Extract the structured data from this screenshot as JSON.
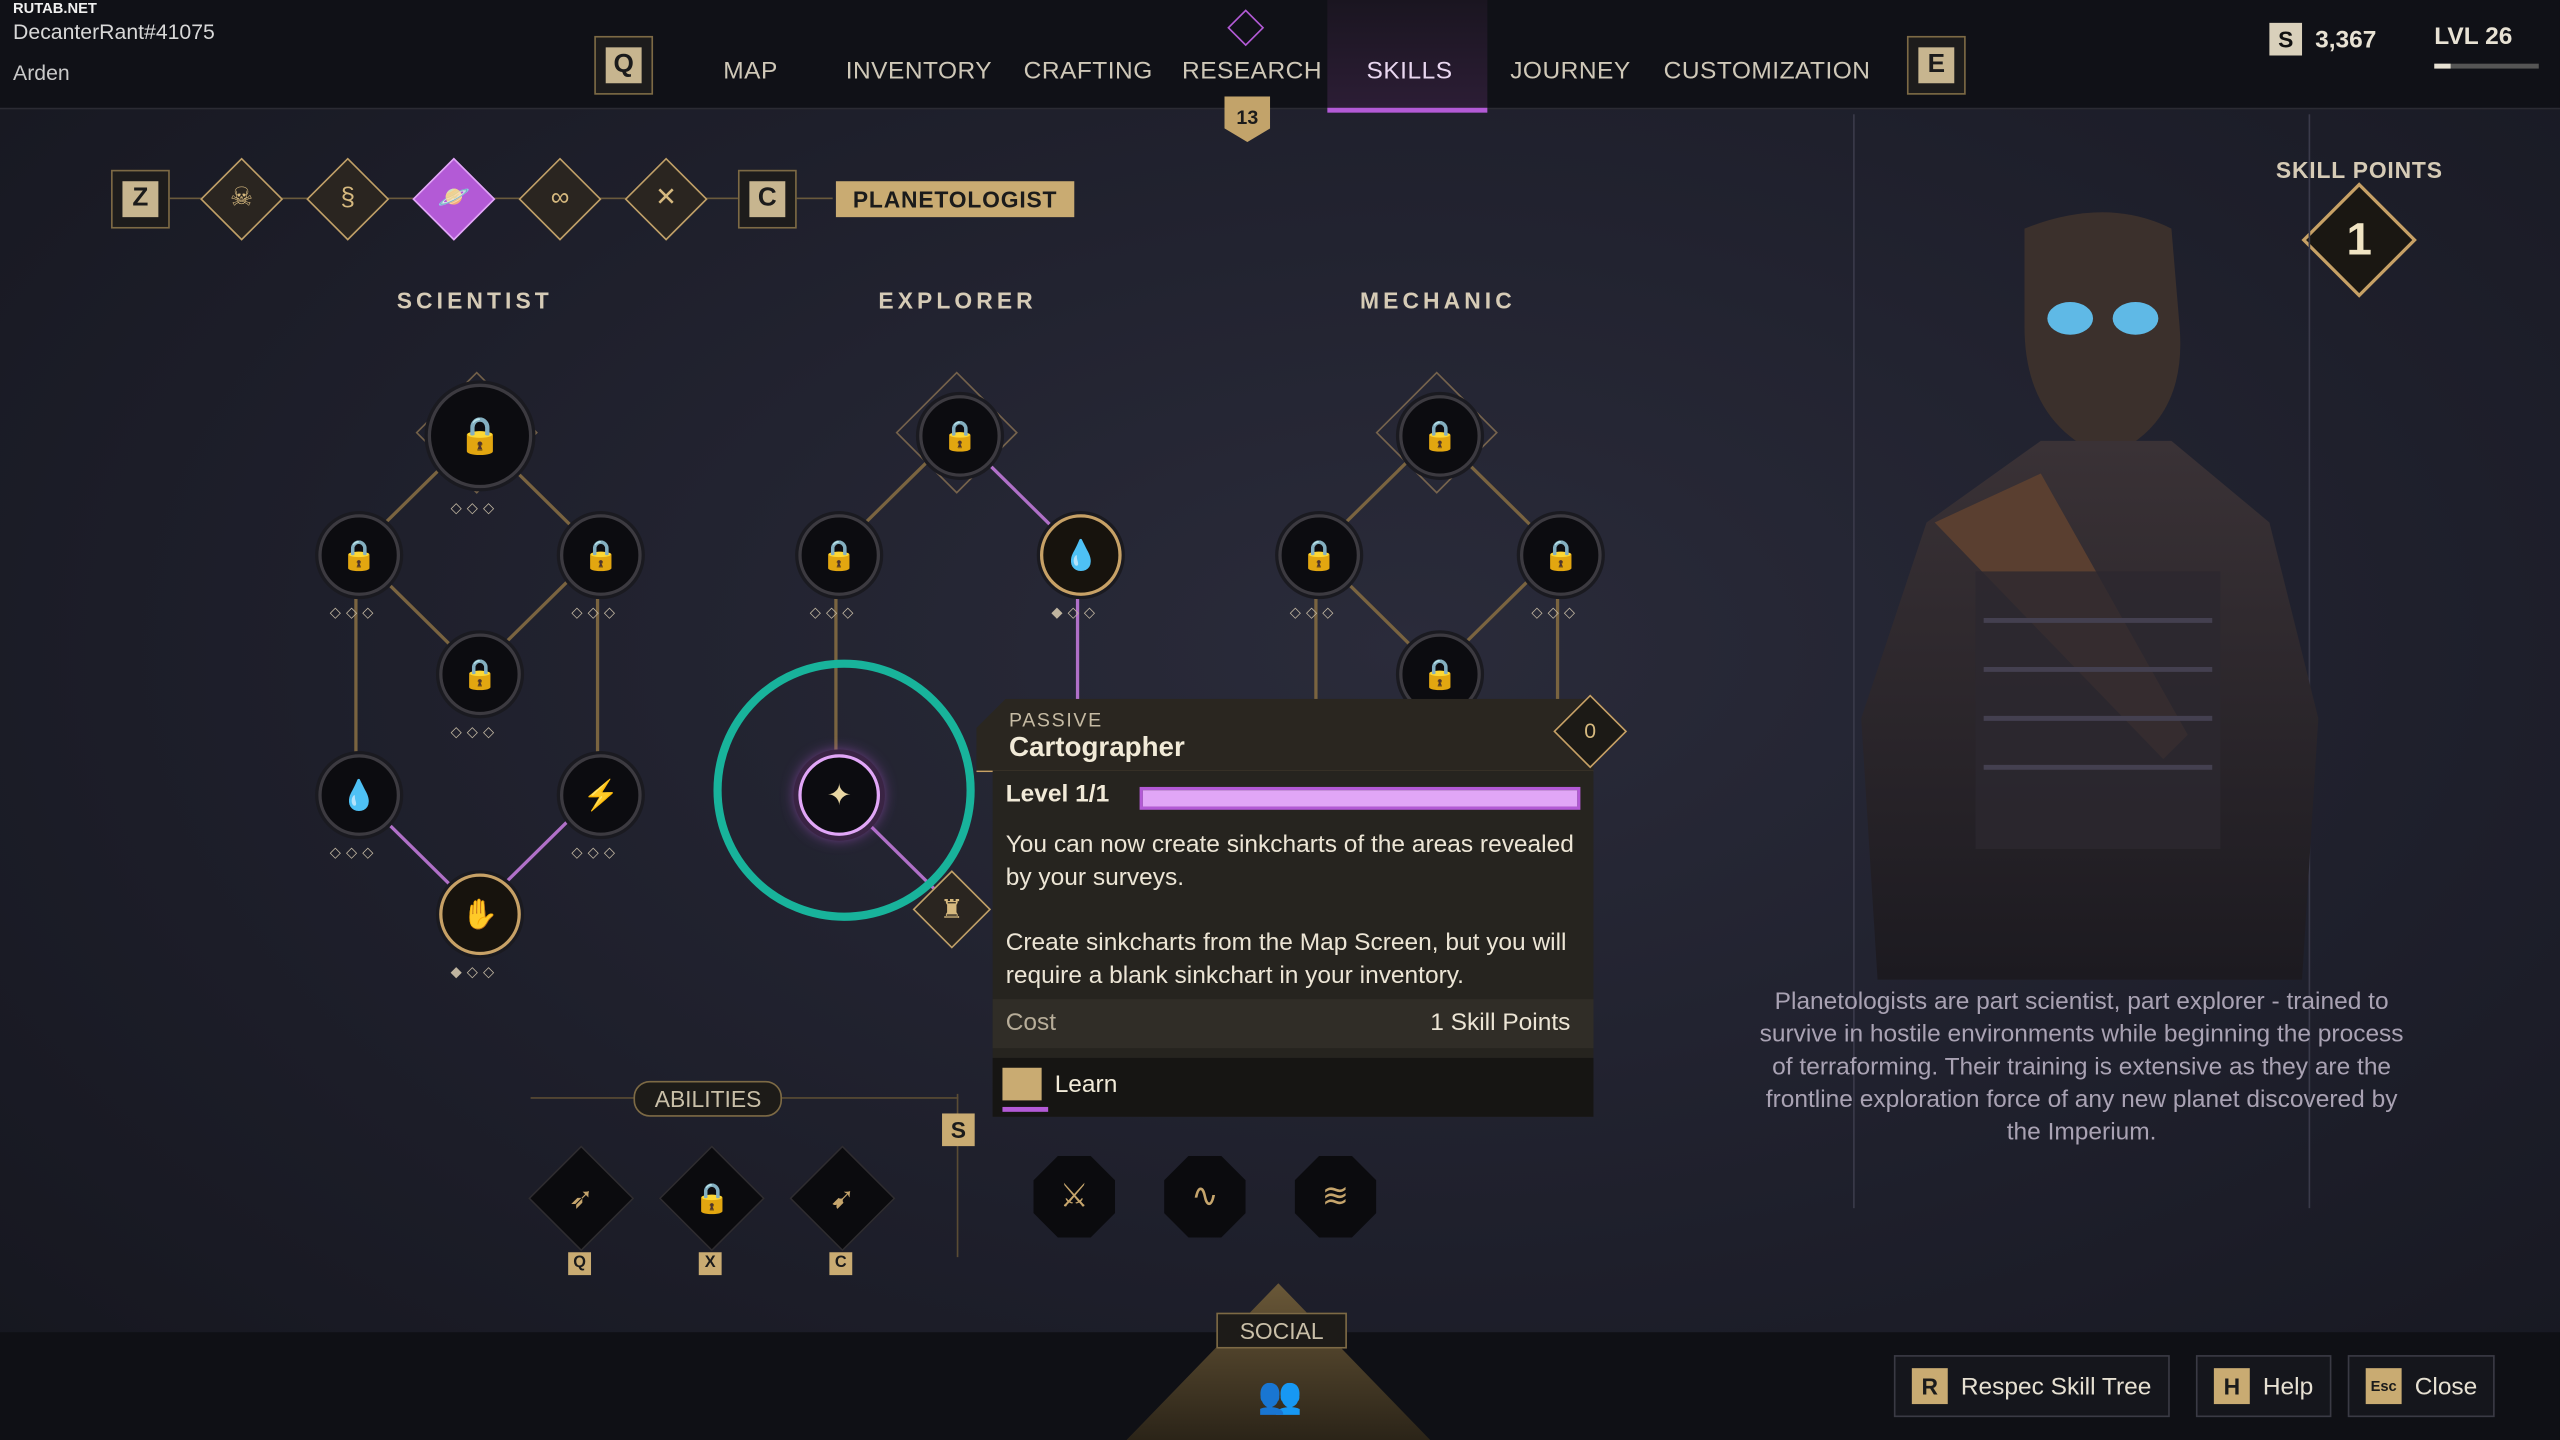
{
  "watermark": "RUTAB.NET",
  "user": {
    "name": "DecanterRant#41075",
    "character": "Arden"
  },
  "nav": {
    "prev_key": "Q",
    "next_key": "E",
    "tabs": [
      "MAP",
      "INVENTORY",
      "CRAFTING",
      "RESEARCH",
      "SKILLS",
      "JOURNEY",
      "CUSTOMIZATION"
    ],
    "active_tab": "SKILLS",
    "research_badge": "13"
  },
  "header": {
    "currency_icon": "S",
    "currency": "3,367",
    "level": "LVL 26",
    "level_progress": 0.15
  },
  "class_bar": {
    "prev_key": "Z",
    "next_key": "C",
    "active_class": "PLANETOLOGIST"
  },
  "columns": [
    "SCIENTIST",
    "EXPLORER",
    "MECHANIC"
  ],
  "tooltip": {
    "kind": "PASSIVE",
    "name": "Cartographer",
    "cost_badge": "0",
    "level": "Level 1/1",
    "level_progress": 1.0,
    "desc1": "You can now create sinkcharts of the areas revealed by your surveys.",
    "desc2": "Create sinkcharts from the Map Screen, but you will require a blank sinkchart in your inventory.",
    "cost_label": "Cost",
    "cost_value": "1 Skill Points",
    "learn_label": "Learn"
  },
  "abilities": {
    "label": "ABILITIES",
    "keys": [
      "Q",
      "X",
      "C"
    ],
    "techniques_key": "S"
  },
  "skill_points": {
    "label": "SKILL POINTS",
    "value": "1"
  },
  "class_description": "Planetologists are part scientist, part explorer - trained to survive in hostile environments while beginning the process of terraforming. Their training is extensive as they are the frontline exploration force of any new planet discovered by the Imperium.",
  "social": {
    "label": "SOCIAL"
  },
  "footer": {
    "respec_key": "R",
    "respec_label": "Respec Skill Tree",
    "help_key": "H",
    "help_label": "Help",
    "close_key": "Esc",
    "close_label": "Close"
  },
  "colors": {
    "accent": "#b35ad6",
    "gold": "#c7a166",
    "highlight_ring": "#18b39b"
  }
}
